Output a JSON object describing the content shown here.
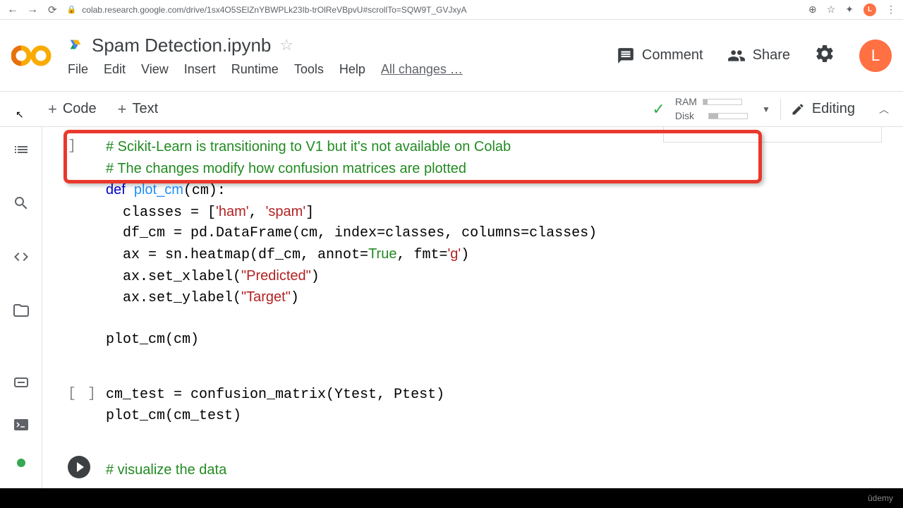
{
  "browser": {
    "url": "colab.research.google.com/drive/1sx4O5SElZnYBWPLk23Ib-trOlReVBpvU#scrollTo=SQW9T_GVJxyA",
    "avatar_letter": "L"
  },
  "header": {
    "title": "Spam Detection.ipynb",
    "menu": [
      "File",
      "Edit",
      "View",
      "Insert",
      "Runtime",
      "Tools",
      "Help"
    ],
    "save_status": "All changes …",
    "comment": "Comment",
    "share": "Share",
    "avatar_letter": "L"
  },
  "toolbar": {
    "code": "Code",
    "text": "Text",
    "ram_label": "RAM",
    "disk_label": "Disk",
    "ram_pct": 12,
    "disk_pct": 25,
    "editing": "Editing"
  },
  "cells": [
    {
      "prompt": "]",
      "code_html": "<span class='comment'># Scikit-Learn is transitioning to V1 but it's not available on Colab</span>\n<span class='comment'># The changes modify how confusion matrices are plotted</span>\n<span class='keyword'>def</span> <span class='fname'>plot_cm</span>(cm):\n  classes = [<span class='string'>'ham'</span>, <span class='string'>'spam'</span>]\n  df_cm = pd.DataFrame(cm, index=classes, columns=classes)\n  ax = sn.heatmap(df_cm, annot=<span class='builtin'>True</span>, fmt=<span class='string'>'g'</span>)\n  ax.set_xlabel(<span class='string'>\"Predicted\"</span>)\n  ax.set_ylabel(<span class='string'>\"Target\"</span>)\n\nplot_cm(cm)",
      "has_highlight": true,
      "has_toolbar": true
    },
    {
      "prompt": "[ ]",
      "code_html": "cm_test = confusion_matrix(Ytest, Ptest)\nplot_cm(cm_test)"
    },
    {
      "has_play": true,
      "code_html": "<span class='comment'># visualize the data</span>"
    }
  ],
  "footer_brand": "ûdemy"
}
